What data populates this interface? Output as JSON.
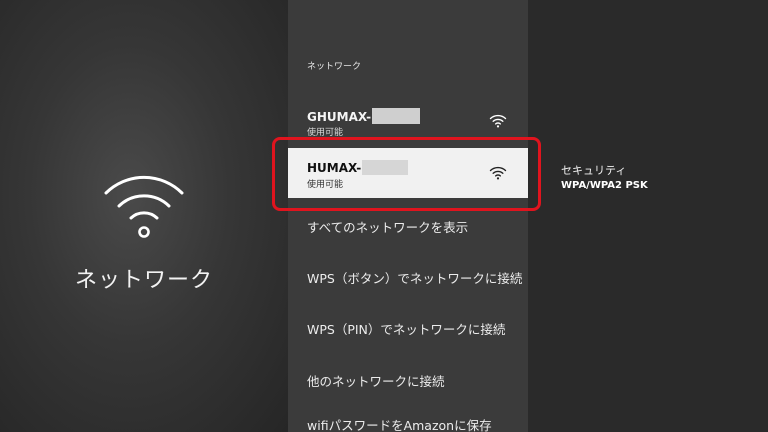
{
  "left": {
    "title": "ネットワーク",
    "icon": "wifi-icon"
  },
  "middle": {
    "section_label": "ネットワーク",
    "networks": [
      {
        "name": "GHUMAX-",
        "status": "使用可能",
        "icon": "wifi-icon",
        "selected": false
      },
      {
        "name": "HUMAX-",
        "status": "使用可能",
        "icon": "wifi-icon",
        "selected": true
      }
    ],
    "menu": [
      "すべてのネットワークを表示",
      "WPS（ボタン）でネットワークに接続",
      "WPS（PIN）でネットワークに接続",
      "他のネットワークに接続",
      "wifiパスワードをAmazonに保存"
    ]
  },
  "right": {
    "security_label": "セキュリティ",
    "security_value": "WPA/WPA2 PSK"
  },
  "colors": {
    "highlight_border": "#e0141e",
    "selected_bg": "#f1f1f1"
  }
}
